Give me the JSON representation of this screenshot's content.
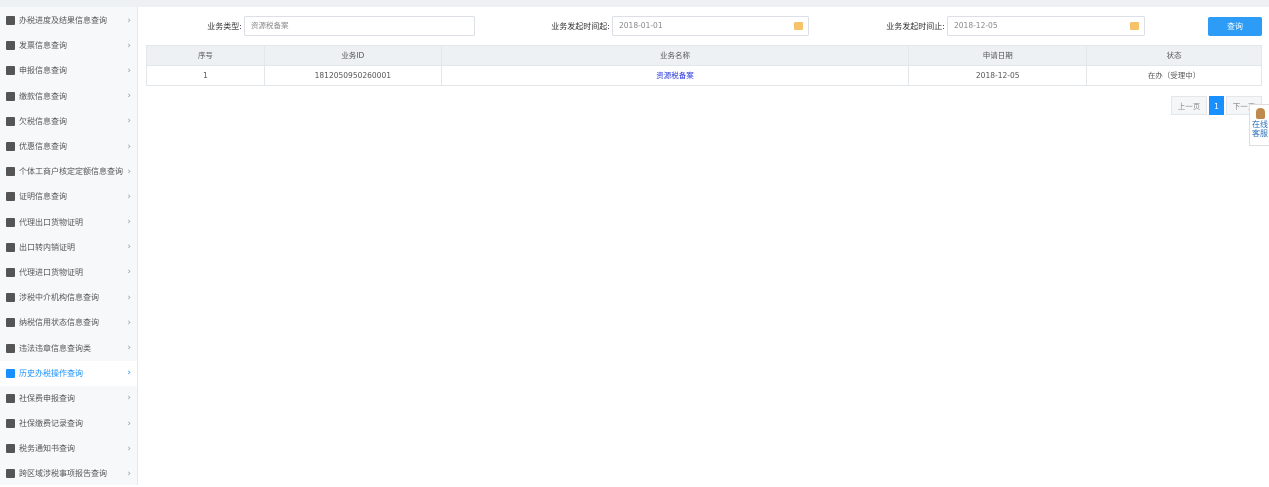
{
  "sidebar": {
    "items": [
      {
        "label": "办税进度及结果信息查询"
      },
      {
        "label": "发票信息查询"
      },
      {
        "label": "申报信息查询"
      },
      {
        "label": "缴款信息查询"
      },
      {
        "label": "欠税信息查询"
      },
      {
        "label": "优惠信息查询"
      },
      {
        "label": "个体工商户核定定额信息查询"
      },
      {
        "label": "证明信息查询"
      },
      {
        "label": "代理出口货物证明"
      },
      {
        "label": "出口转内销证明"
      },
      {
        "label": "代理进口货物证明"
      },
      {
        "label": "涉税中介机构信息查询"
      },
      {
        "label": "纳税信用状态信息查询"
      },
      {
        "label": "违法违章信息查询类"
      },
      {
        "label": "历史办税操作查询",
        "active": true
      },
      {
        "label": "社保费申报查询"
      },
      {
        "label": "社保缴费记录查询"
      },
      {
        "label": "税务通知书查询"
      },
      {
        "label": "跨区域涉税事项报告查询"
      }
    ]
  },
  "form": {
    "type_label": "业务类型:",
    "type_value": "资源税备案",
    "start_label": "业务发起时间起:",
    "start_value": "2018-01-01",
    "end_label": "业务发起时间止:",
    "end_value": "2018-12-05",
    "query_label": "查询"
  },
  "table": {
    "headers": [
      "序号",
      "业务ID",
      "业务名称",
      "申请日期",
      "状态"
    ],
    "rows": [
      [
        "1",
        "1812050950260001",
        "资源税备案",
        "2018-12-05",
        "在办（受理中）"
      ]
    ]
  },
  "pagination": {
    "prev": "上一页",
    "current": "1",
    "next": "下一页"
  },
  "service": {
    "line1": "在线",
    "line2": "客服"
  },
  "colors": {
    "accent": "#1890ff",
    "button": "#2d9cf6",
    "link": "#2233dd"
  }
}
